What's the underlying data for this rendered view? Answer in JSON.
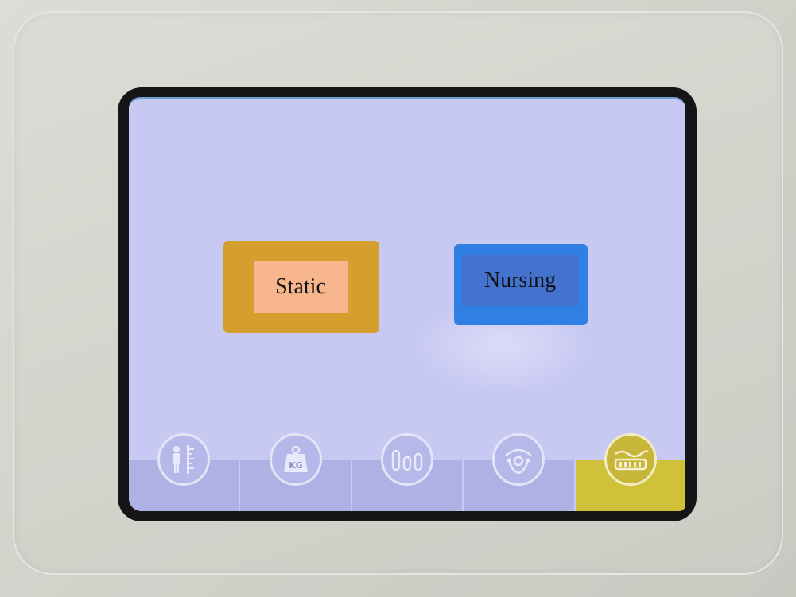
{
  "modes": {
    "static_label": "Static",
    "nursing_label": "Nursing"
  },
  "tabs": [
    {
      "icon": "height-measure-icon",
      "active": false
    },
    {
      "icon": "weight-kg-icon",
      "label": "KG",
      "active": false
    },
    {
      "icon": "bars-chart-icon",
      "active": false
    },
    {
      "icon": "position-icon",
      "active": false
    },
    {
      "icon": "mattress-wave-icon",
      "active": true
    }
  ],
  "colors": {
    "screen_bg": "#c8c9f3",
    "static_button": "#d49f2f",
    "static_label_bg": "#f6b58d",
    "nursing_button": "#2f7fe4",
    "nursing_label_bg": "#4472cf",
    "tab_bg": "#aeb1e3",
    "tab_active_bg": "#cfc13a"
  }
}
